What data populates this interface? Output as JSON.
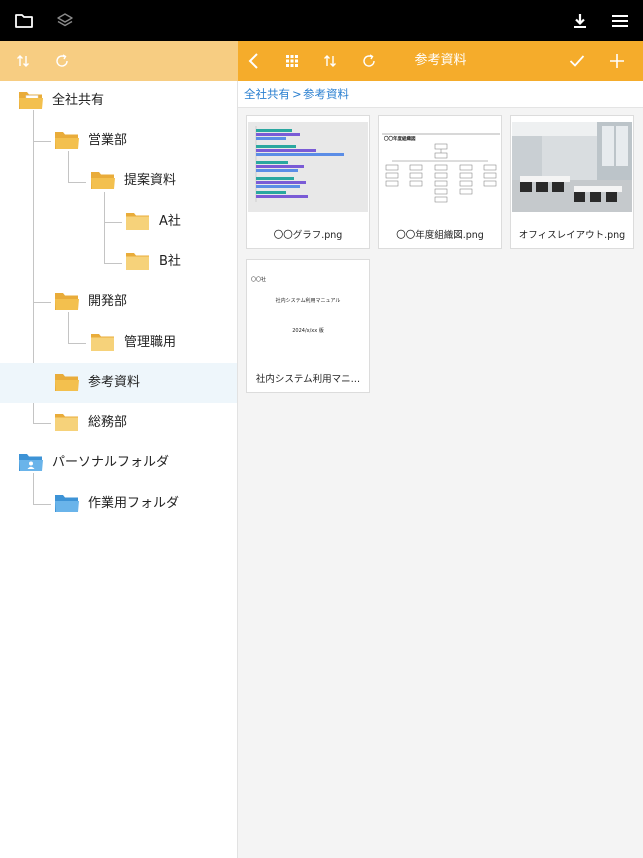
{
  "icons": {
    "folder": "folder-icon",
    "layers": "layers-icon",
    "download": "download-icon",
    "menu": "hamburger-menu-icon",
    "sort": "sort-icon",
    "refresh": "refresh-icon",
    "back": "chevron-left-icon",
    "grid": "grid-view-icon",
    "check": "check-icon",
    "add": "plus-icon"
  },
  "colors": {
    "accent": "#f5ac2b",
    "accent_light": "#f7cd82",
    "folder": "#f3c04e",
    "personal_folder": "#58a9e4",
    "link": "#2a7fd0",
    "selected_row": "#eef6fb"
  },
  "toolbar": {
    "title": "参考資料"
  },
  "breadcrumb": {
    "root": "全社共有",
    "sep": ">",
    "current": "参考資料"
  },
  "tree": [
    {
      "label": "全社共有"
    },
    {
      "label": "営業部"
    },
    {
      "label": "提案資料"
    },
    {
      "label": "A社"
    },
    {
      "label": "B社"
    },
    {
      "label": "開発部"
    },
    {
      "label": "管理職用"
    },
    {
      "label": "参考資料"
    },
    {
      "label": "総務部"
    },
    {
      "label": "パーソナルフォルダ"
    },
    {
      "label": "作業用フォルダ"
    }
  ],
  "files": [
    {
      "name": "〇〇グラフ.png"
    },
    {
      "name": "〇〇年度組織図.png",
      "thumb_title": "〇〇年度組織図"
    },
    {
      "name": "オフィスレイアウト.png"
    },
    {
      "name": "社内システム利用マニ…",
      "thumb_company": "〇〇社",
      "thumb_title": "社内システム利用マニュアル",
      "thumb_version": "2024/x/xx 版"
    }
  ]
}
